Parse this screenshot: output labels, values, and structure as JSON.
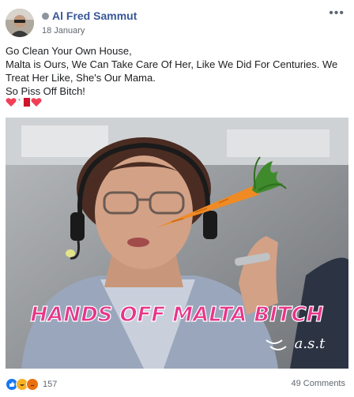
{
  "post": {
    "author": "Al Fred Sammut",
    "date": "18 January",
    "more_label": "•••",
    "text_lines": [
      "Go Clean Your Own House,",
      "Malta is Ours, We Can Take Care Of Her, Like We Did For Centuries. We",
      "Treat Her Like, She's Our Mama.",
      "So Piss Off Bitch!"
    ],
    "emoji_line": [
      "heart",
      "malta-flag",
      "heart"
    ],
    "image": {
      "caption": "HANDS OFF MALTA BITCH",
      "watermark": "a.s.t"
    },
    "reaction_count": "157",
    "comments_label": "49 Comments",
    "colors": {
      "link": "#385898",
      "heart": "#f33e58",
      "caption": "#e8358a"
    }
  }
}
